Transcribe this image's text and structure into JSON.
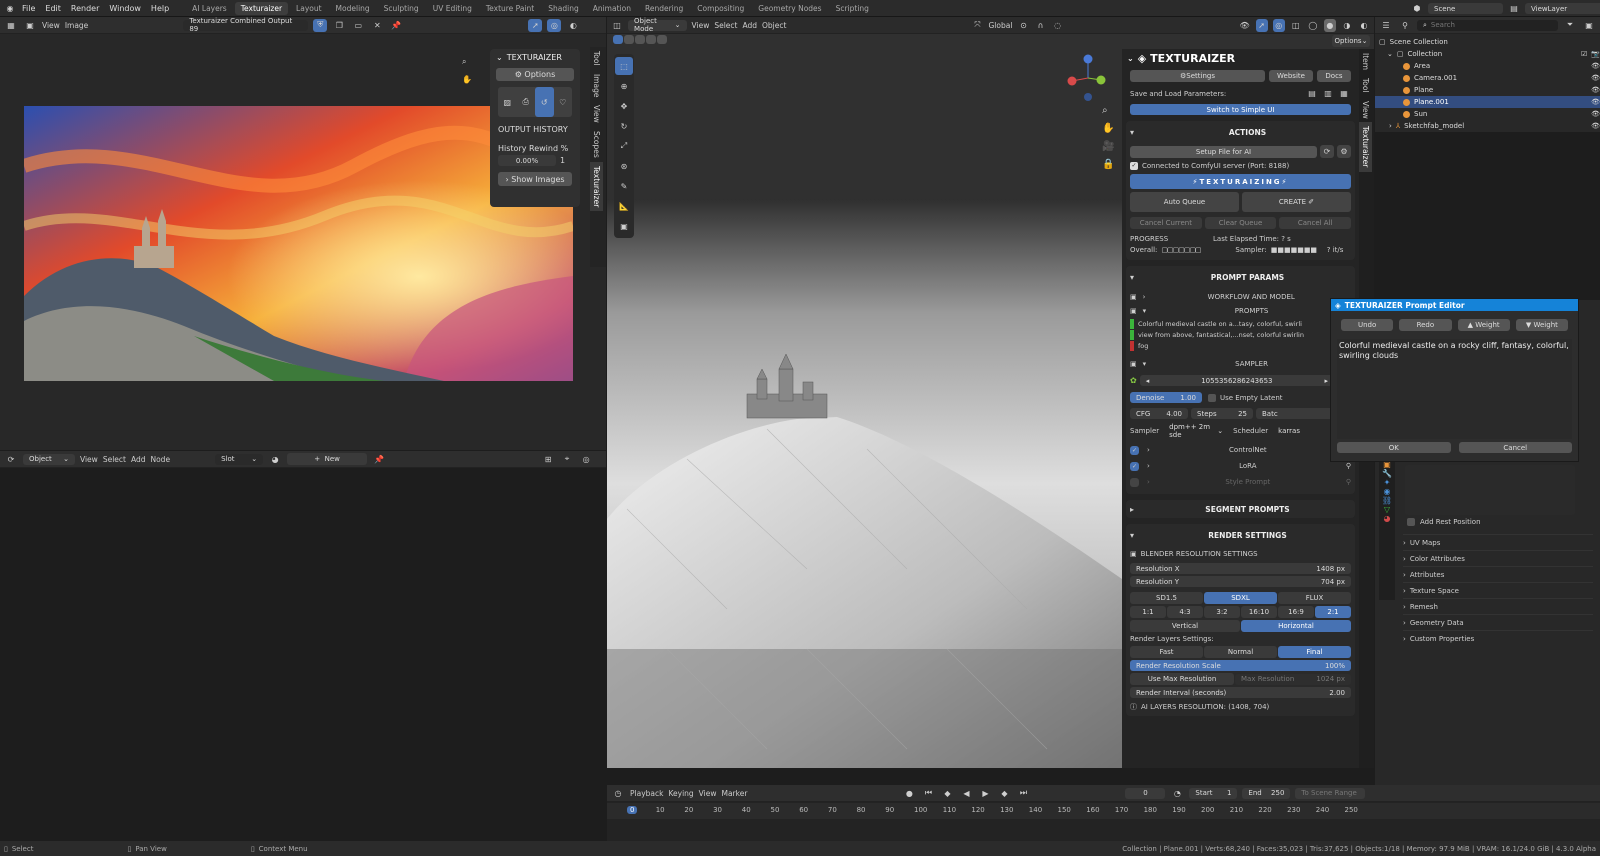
{
  "topbar": {
    "menus": [
      "File",
      "Edit",
      "Render",
      "Window",
      "Help"
    ],
    "workspaces": [
      "AI Layers",
      "Texturaizer",
      "Layout",
      "Modeling",
      "Sculpting",
      "UV Editing",
      "Texture Paint",
      "Shading",
      "Animation",
      "Rendering",
      "Compositing",
      "Geometry Nodes",
      "Scripting"
    ],
    "scene_label": "Scene",
    "viewlayer_label": "ViewLayer"
  },
  "image_editor": {
    "view": "View",
    "image": "Image",
    "image_name": "Texturaizer Combined Output 89",
    "panel": {
      "title": "TEXTURAIZER",
      "options": "Options",
      "output_history": "OUTPUT HISTORY",
      "rewind_label": "History Rewind %",
      "rewind_value": "0.00%",
      "rewind_step": "1",
      "show_images": "Show Images"
    },
    "tabs": [
      "Tool",
      "Image",
      "View",
      "Scopes",
      "Texturaizer"
    ]
  },
  "node_editor": {
    "mode": "Object",
    "view": "View",
    "select": "Select",
    "add": "Add",
    "node": "Node",
    "slot": "Slot",
    "new": "New"
  },
  "viewport": {
    "mode": "Object Mode",
    "view": "View",
    "select": "Select",
    "add": "Add",
    "object": "Object",
    "orientation": "Global",
    "options": "Options",
    "side_tabs": [
      "Item",
      "Tool",
      "View",
      "Texturaizer"
    ]
  },
  "texturaizer": {
    "brand": "TEXTURAIZER",
    "settings": "Settings",
    "website": "Website",
    "docs": "Docs",
    "save_load": "Save and Load Parameters:",
    "switch_ui": "Switch to Simple UI",
    "actions": "ACTIONS",
    "setup": "Setup File for AI",
    "connected": "Connected to ComfyUI server (Port: 8188)",
    "texturizing": "TEXTURAIZING",
    "auto_queue": "Auto Queue",
    "create": "CREATE",
    "cancel_current": "Cancel Current",
    "clear_queue": "Clear Queue",
    "cancel_all": "Cancel All",
    "progress": "PROGRESS",
    "overall": "Overall:",
    "elapsed": "Last Elapsed Time: ? s",
    "sampler_prog": "Sampler:",
    "its": "? it/s",
    "prompt_params": "PROMPT PARAMS",
    "workflow": "WORKFLOW AND MODEL",
    "prompts": "PROMPTS",
    "prompt_lines": [
      "Colorful medieval castle on a...tasy, colorful, swirli",
      "view from above, fantastical,...nset, colorful swirlin",
      "fog"
    ],
    "sampler": "SAMPLER",
    "seed": "1055356286243653",
    "denoise_label": "Denoise",
    "denoise_value": "1.00",
    "use_empty_latent": "Use Empty Latent",
    "cfg_label": "CFG",
    "cfg_value": "4.00",
    "steps_label": "Steps",
    "steps_value": "25",
    "batch_label": "Batc",
    "sampler_label": "Sampler",
    "sampler_value": "dpm++ 2m sde",
    "scheduler_label": "Scheduler",
    "scheduler_value": "karras",
    "controlnet": "ControlNet",
    "lora": "LoRA",
    "style_prompt": "Style Prompt",
    "segment_prompts": "SEGMENT PROMPTS",
    "render_settings": "RENDER SETTINGS",
    "blender_res": "BLENDER RESOLUTION SETTINGS",
    "res_x_label": "Resolution X",
    "res_x": "1408 px",
    "res_y_label": "Resolution Y",
    "res_y": "704 px",
    "models": [
      "SD1.5",
      "SDXL",
      "FLUX"
    ],
    "ratios": [
      "1:1",
      "4:3",
      "3:2",
      "16:10",
      "16:9",
      "2:1"
    ],
    "orient": [
      "Vertical",
      "Horizontal"
    ],
    "render_layers": "Render Layers Settings:",
    "quality": [
      "Fast",
      "Normal",
      "Final"
    ],
    "scale_label": "Render Resolution Scale",
    "scale_value": "100%",
    "use_max": "Use Max Resolution",
    "max_res_label": "Max Resolution",
    "max_res": "1024 px",
    "interval_label": "Render Interval (seconds)",
    "interval_value": "2.00",
    "ai_res": "AI LAYERS RESOLUTION: (1408, 704)"
  },
  "prompt_editor": {
    "title": "TEXTURAIZER Prompt Editor",
    "undo": "Undo",
    "redo": "Redo",
    "weight_up": "▲ Weight",
    "weight_down": "▼ Weight",
    "text": "Colorful medieval castle on a rocky cliff, fantasy, colorful, swirling clouds",
    "ok": "OK",
    "cancel": "Cancel"
  },
  "outliner": {
    "search": "Search",
    "rows": [
      "Scene Collection",
      "Collection",
      "Area",
      "Camera.001",
      "Plane",
      "Plane.001",
      "Sun",
      "Sketchfab_model"
    ]
  },
  "properties": {
    "add_rest": "Add Rest Position",
    "sections": [
      "UV Maps",
      "Color Attributes",
      "Attributes",
      "Texture Space",
      "Remesh",
      "Geometry Data",
      "Custom Properties"
    ]
  },
  "timeline": {
    "playback": "Playback",
    "keying": "Keying",
    "view": "View",
    "marker": "Marker",
    "frame": "0",
    "start_label": "Start",
    "start": "1",
    "end_label": "End",
    "end": "250",
    "scene_range": "To Scene Range",
    "ticks": [
      "0",
      "10",
      "20",
      "30",
      "40",
      "50",
      "60",
      "70",
      "80",
      "90",
      "100",
      "110",
      "120",
      "130",
      "140",
      "150",
      "160",
      "170",
      "180",
      "190",
      "200",
      "210",
      "220",
      "230",
      "240",
      "250"
    ]
  },
  "statusbar": {
    "select": "Select",
    "pan": "Pan View",
    "context": "Context Menu",
    "info": "Collection | Plane.001 | Verts:68,240 | Faces:35,023 | Tris:37,625 | Objects:1/18 | Memory: 97.9 MiB | VRAM: 16.1/24.0 GiB | 4.3.0 Alpha"
  }
}
